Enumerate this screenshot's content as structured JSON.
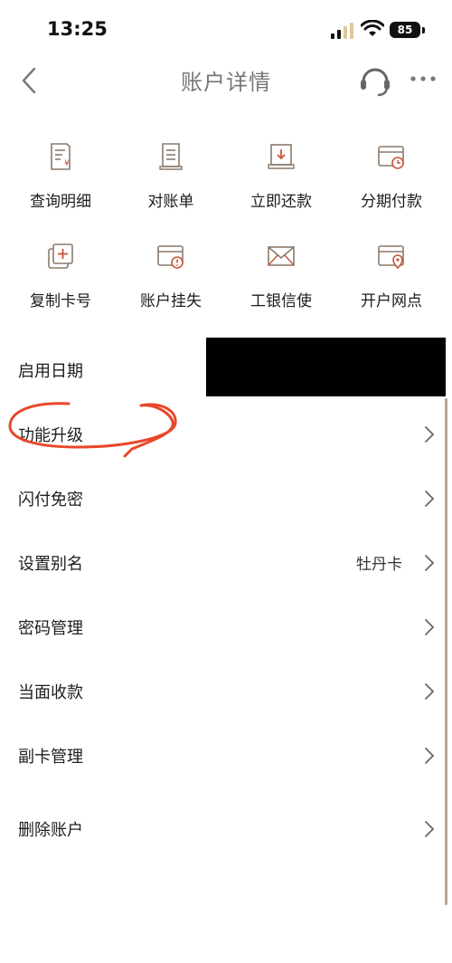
{
  "status_bar": {
    "time": "13:25",
    "battery": "85"
  },
  "nav": {
    "title": "账户详情"
  },
  "grid": [
    {
      "label": "查询明细",
      "icon": "receipt-yen-icon"
    },
    {
      "label": "对账单",
      "icon": "statement-icon"
    },
    {
      "label": "立即还款",
      "icon": "repay-icon"
    },
    {
      "label": "分期付款",
      "icon": "installment-card-icon"
    },
    {
      "label": "复制卡号",
      "icon": "copy-card-icon"
    },
    {
      "label": "账户挂失",
      "icon": "report-loss-card-icon"
    },
    {
      "label": "工银信使",
      "icon": "envelope-icon"
    },
    {
      "label": "开户网点",
      "icon": "branch-location-card-icon"
    }
  ],
  "list": [
    {
      "label": "启用日期",
      "value": ""
    },
    {
      "label": "功能升级",
      "value": ""
    },
    {
      "label": "闪付免密",
      "value": ""
    },
    {
      "label": "设置别名",
      "value": "牡丹卡"
    },
    {
      "label": "密码管理",
      "value": ""
    },
    {
      "label": "当面收款",
      "value": ""
    },
    {
      "label": "副卡管理",
      "value": ""
    },
    {
      "label": "删除账户",
      "value": ""
    }
  ],
  "colors": {
    "accent": "#c8553a",
    "icon_stroke": "#8a7a6a",
    "annotation": "#e8472a"
  }
}
